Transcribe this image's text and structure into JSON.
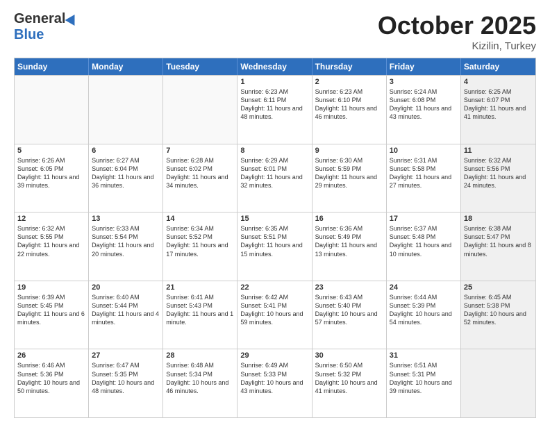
{
  "header": {
    "logo_general": "General",
    "logo_blue": "Blue",
    "month_title": "October 2025",
    "location": "Kizilin, Turkey"
  },
  "weekdays": [
    "Sunday",
    "Monday",
    "Tuesday",
    "Wednesday",
    "Thursday",
    "Friday",
    "Saturday"
  ],
  "rows": [
    [
      {
        "day": "",
        "info": "",
        "shaded": false,
        "empty": true
      },
      {
        "day": "",
        "info": "",
        "shaded": false,
        "empty": true
      },
      {
        "day": "",
        "info": "",
        "shaded": false,
        "empty": true
      },
      {
        "day": "1",
        "info": "Sunrise: 6:23 AM\nSunset: 6:11 PM\nDaylight: 11 hours and 48 minutes.",
        "shaded": false,
        "empty": false
      },
      {
        "day": "2",
        "info": "Sunrise: 6:23 AM\nSunset: 6:10 PM\nDaylight: 11 hours and 46 minutes.",
        "shaded": false,
        "empty": false
      },
      {
        "day": "3",
        "info": "Sunrise: 6:24 AM\nSunset: 6:08 PM\nDaylight: 11 hours and 43 minutes.",
        "shaded": false,
        "empty": false
      },
      {
        "day": "4",
        "info": "Sunrise: 6:25 AM\nSunset: 6:07 PM\nDaylight: 11 hours and 41 minutes.",
        "shaded": true,
        "empty": false
      }
    ],
    [
      {
        "day": "5",
        "info": "Sunrise: 6:26 AM\nSunset: 6:05 PM\nDaylight: 11 hours and 39 minutes.",
        "shaded": false,
        "empty": false
      },
      {
        "day": "6",
        "info": "Sunrise: 6:27 AM\nSunset: 6:04 PM\nDaylight: 11 hours and 36 minutes.",
        "shaded": false,
        "empty": false
      },
      {
        "day": "7",
        "info": "Sunrise: 6:28 AM\nSunset: 6:02 PM\nDaylight: 11 hours and 34 minutes.",
        "shaded": false,
        "empty": false
      },
      {
        "day": "8",
        "info": "Sunrise: 6:29 AM\nSunset: 6:01 PM\nDaylight: 11 hours and 32 minutes.",
        "shaded": false,
        "empty": false
      },
      {
        "day": "9",
        "info": "Sunrise: 6:30 AM\nSunset: 5:59 PM\nDaylight: 11 hours and 29 minutes.",
        "shaded": false,
        "empty": false
      },
      {
        "day": "10",
        "info": "Sunrise: 6:31 AM\nSunset: 5:58 PM\nDaylight: 11 hours and 27 minutes.",
        "shaded": false,
        "empty": false
      },
      {
        "day": "11",
        "info": "Sunrise: 6:32 AM\nSunset: 5:56 PM\nDaylight: 11 hours and 24 minutes.",
        "shaded": true,
        "empty": false
      }
    ],
    [
      {
        "day": "12",
        "info": "Sunrise: 6:32 AM\nSunset: 5:55 PM\nDaylight: 11 hours and 22 minutes.",
        "shaded": false,
        "empty": false
      },
      {
        "day": "13",
        "info": "Sunrise: 6:33 AM\nSunset: 5:54 PM\nDaylight: 11 hours and 20 minutes.",
        "shaded": false,
        "empty": false
      },
      {
        "day": "14",
        "info": "Sunrise: 6:34 AM\nSunset: 5:52 PM\nDaylight: 11 hours and 17 minutes.",
        "shaded": false,
        "empty": false
      },
      {
        "day": "15",
        "info": "Sunrise: 6:35 AM\nSunset: 5:51 PM\nDaylight: 11 hours and 15 minutes.",
        "shaded": false,
        "empty": false
      },
      {
        "day": "16",
        "info": "Sunrise: 6:36 AM\nSunset: 5:49 PM\nDaylight: 11 hours and 13 minutes.",
        "shaded": false,
        "empty": false
      },
      {
        "day": "17",
        "info": "Sunrise: 6:37 AM\nSunset: 5:48 PM\nDaylight: 11 hours and 10 minutes.",
        "shaded": false,
        "empty": false
      },
      {
        "day": "18",
        "info": "Sunrise: 6:38 AM\nSunset: 5:47 PM\nDaylight: 11 hours and 8 minutes.",
        "shaded": true,
        "empty": false
      }
    ],
    [
      {
        "day": "19",
        "info": "Sunrise: 6:39 AM\nSunset: 5:45 PM\nDaylight: 11 hours and 6 minutes.",
        "shaded": false,
        "empty": false
      },
      {
        "day": "20",
        "info": "Sunrise: 6:40 AM\nSunset: 5:44 PM\nDaylight: 11 hours and 4 minutes.",
        "shaded": false,
        "empty": false
      },
      {
        "day": "21",
        "info": "Sunrise: 6:41 AM\nSunset: 5:43 PM\nDaylight: 11 hours and 1 minute.",
        "shaded": false,
        "empty": false
      },
      {
        "day": "22",
        "info": "Sunrise: 6:42 AM\nSunset: 5:41 PM\nDaylight: 10 hours and 59 minutes.",
        "shaded": false,
        "empty": false
      },
      {
        "day": "23",
        "info": "Sunrise: 6:43 AM\nSunset: 5:40 PM\nDaylight: 10 hours and 57 minutes.",
        "shaded": false,
        "empty": false
      },
      {
        "day": "24",
        "info": "Sunrise: 6:44 AM\nSunset: 5:39 PM\nDaylight: 10 hours and 54 minutes.",
        "shaded": false,
        "empty": false
      },
      {
        "day": "25",
        "info": "Sunrise: 6:45 AM\nSunset: 5:38 PM\nDaylight: 10 hours and 52 minutes.",
        "shaded": true,
        "empty": false
      }
    ],
    [
      {
        "day": "26",
        "info": "Sunrise: 6:46 AM\nSunset: 5:36 PM\nDaylight: 10 hours and 50 minutes.",
        "shaded": false,
        "empty": false
      },
      {
        "day": "27",
        "info": "Sunrise: 6:47 AM\nSunset: 5:35 PM\nDaylight: 10 hours and 48 minutes.",
        "shaded": false,
        "empty": false
      },
      {
        "day": "28",
        "info": "Sunrise: 6:48 AM\nSunset: 5:34 PM\nDaylight: 10 hours and 46 minutes.",
        "shaded": false,
        "empty": false
      },
      {
        "day": "29",
        "info": "Sunrise: 6:49 AM\nSunset: 5:33 PM\nDaylight: 10 hours and 43 minutes.",
        "shaded": false,
        "empty": false
      },
      {
        "day": "30",
        "info": "Sunrise: 6:50 AM\nSunset: 5:32 PM\nDaylight: 10 hours and 41 minutes.",
        "shaded": false,
        "empty": false
      },
      {
        "day": "31",
        "info": "Sunrise: 6:51 AM\nSunset: 5:31 PM\nDaylight: 10 hours and 39 minutes.",
        "shaded": false,
        "empty": false
      },
      {
        "day": "",
        "info": "",
        "shaded": true,
        "empty": true
      }
    ]
  ]
}
